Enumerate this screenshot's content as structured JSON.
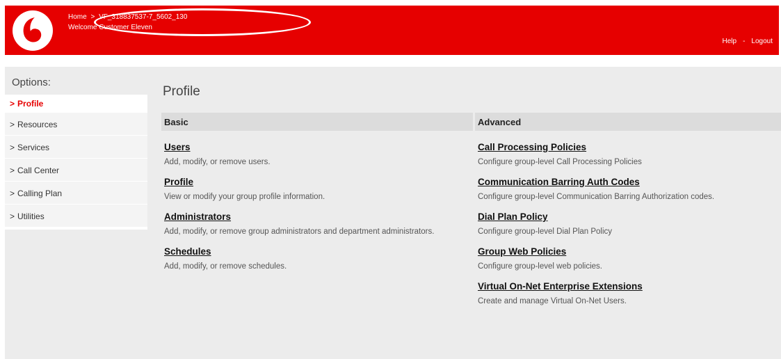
{
  "header": {
    "home_label": "Home",
    "group_id": "VF_318837537-7_5602_130",
    "welcome": "Welcome Customer Eleven",
    "help_label": "Help",
    "separator": "-",
    "logout_label": "Logout",
    "brand_color": "#e60000"
  },
  "sidebar": {
    "title": "Options:",
    "chevron": ">",
    "items": [
      {
        "label": "Profile",
        "active": true
      },
      {
        "label": "Resources"
      },
      {
        "label": "Services"
      },
      {
        "label": "Call Center"
      },
      {
        "label": "Calling Plan"
      },
      {
        "label": "Utilities"
      }
    ]
  },
  "main": {
    "title": "Profile",
    "basic": {
      "header": "Basic",
      "entries": [
        {
          "title": "Users",
          "desc": "Add, modify, or remove users."
        },
        {
          "title": "Profile",
          "desc": "View or modify your group profile information."
        },
        {
          "title": "Administrators",
          "desc": "Add, modify, or remove group administrators and department administrators."
        },
        {
          "title": "Schedules",
          "desc": "Add, modify, or remove schedules."
        }
      ]
    },
    "advanced": {
      "header": "Advanced",
      "entries": [
        {
          "title": "Call Processing Policies",
          "desc": "Configure group-level Call Processing Policies"
        },
        {
          "title": "Communication Barring Auth Codes",
          "desc": "Configure group-level Communication Barring Authorization codes."
        },
        {
          "title": "Dial Plan Policy",
          "desc": "Configure group-level Dial Plan Policy"
        },
        {
          "title": "Group Web Policies",
          "desc": "Configure group-level web policies."
        },
        {
          "title": "Virtual On-Net Enterprise Extensions",
          "desc": "Create and manage Virtual On-Net Users."
        }
      ]
    }
  }
}
